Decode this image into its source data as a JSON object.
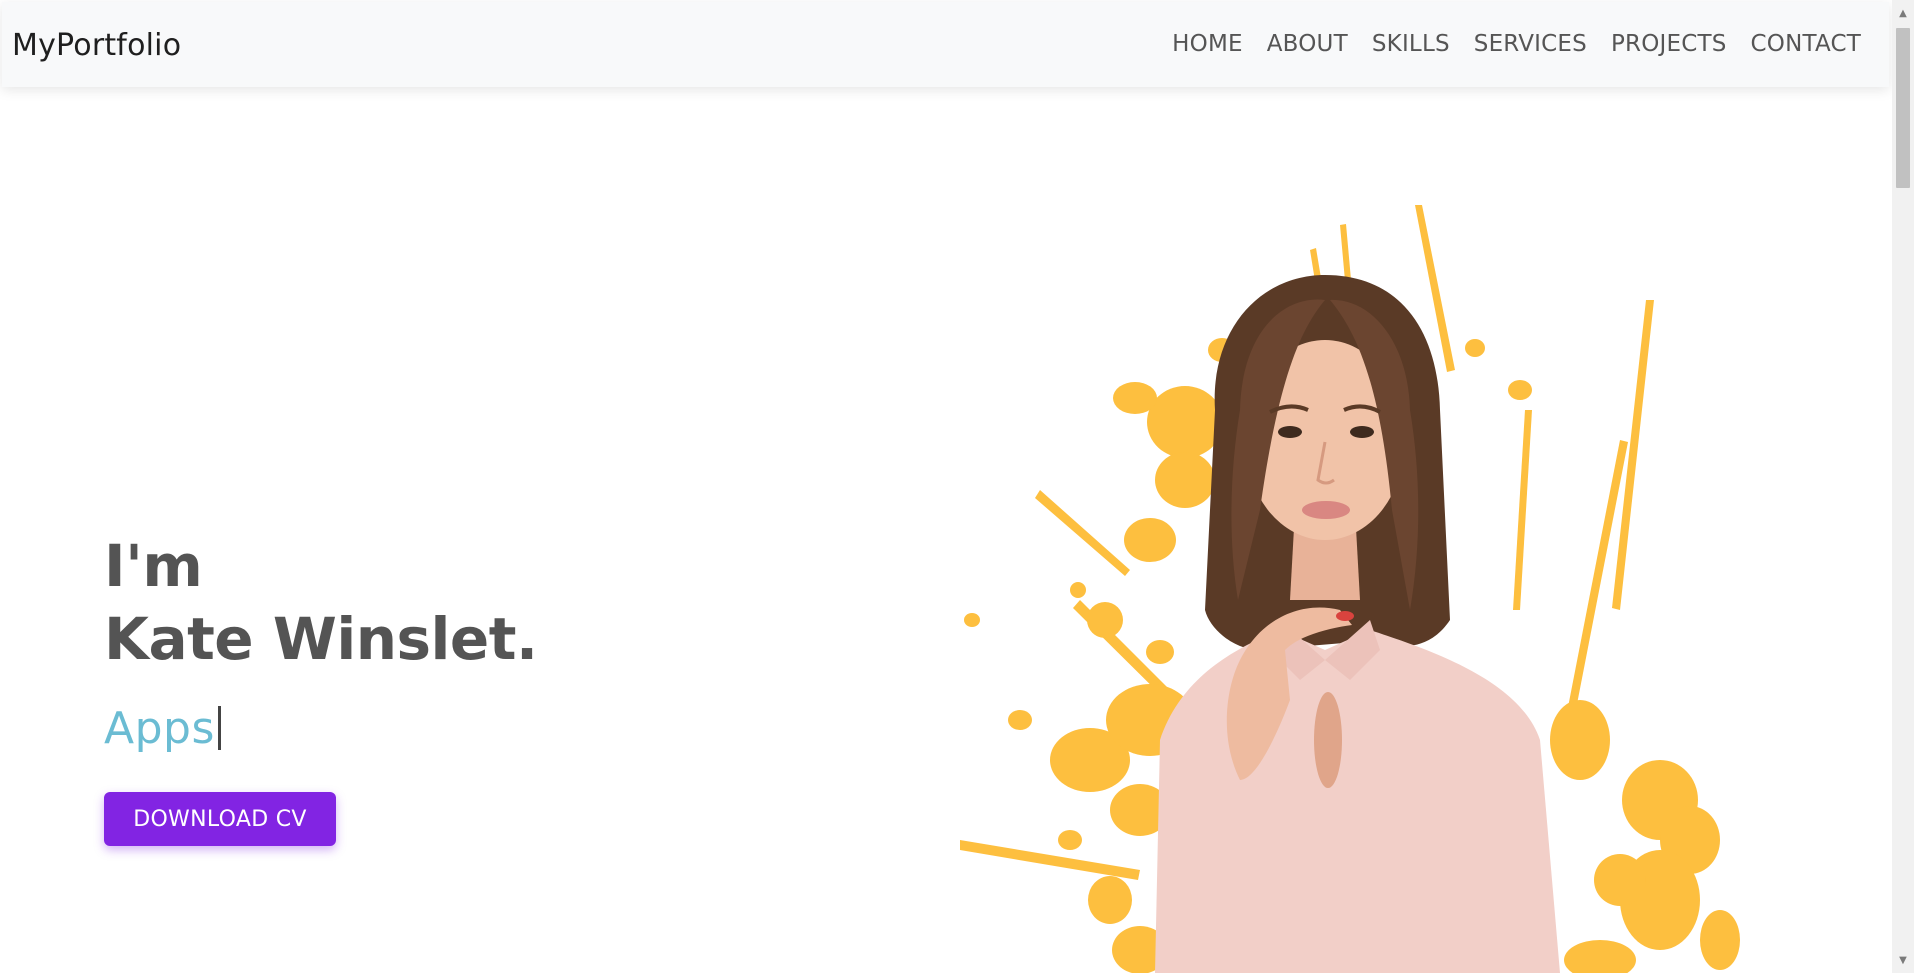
{
  "navbar": {
    "brand": "MyPortfolio",
    "links": [
      {
        "label": "HOME"
      },
      {
        "label": "ABOUT"
      },
      {
        "label": "SKILLS"
      },
      {
        "label": "SERVICES"
      },
      {
        "label": "PROJECTS"
      },
      {
        "label": "CONTACT"
      }
    ]
  },
  "hero": {
    "greeting": "I'm",
    "name": "Kate Winslet.",
    "typed_text": "Apps",
    "download_button": "DOWNLOAD CV"
  },
  "colors": {
    "accent": "#8224e3",
    "typed_text": "#6bbcd3",
    "heading": "#545454",
    "paint_splash": "#fdbf3f",
    "navbar_bg": "#f8f9fa"
  },
  "icons": {
    "scroll_up": "scroll-up-arrow-icon",
    "scroll_down": "scroll-down-arrow-icon"
  }
}
